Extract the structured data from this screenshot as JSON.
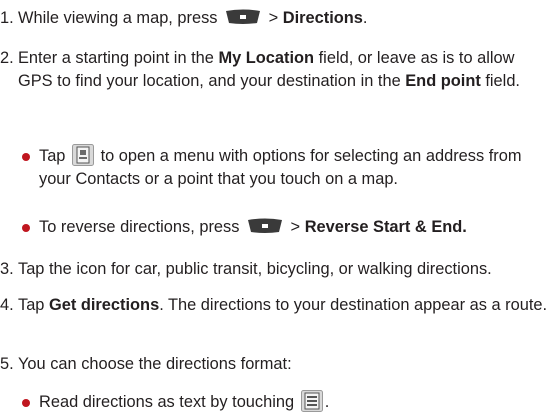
{
  "steps": [
    {
      "num": "1.",
      "pre": "While viewing a map, press",
      "icon": "menu-key-icon",
      "mid": " > ",
      "bold": "Directions",
      "post": "."
    },
    {
      "num": "2.",
      "t1": "Enter a starting point in the ",
      "b1": "My Location",
      "t2": " field, or leave as is to allow GPS to find your location, and your destination in the ",
      "b2": "End point",
      "t3": " field."
    },
    {
      "num": "3.",
      "text": "Tap the icon for car, public transit, bicycling, or walking directions."
    },
    {
      "num": "4.",
      "t1": "Tap ",
      "b1": "Get directions",
      "t2": ". The directions to your destination appear as a route."
    },
    {
      "num": "5.",
      "text": "You can choose the directions format:"
    }
  ],
  "bullets": [
    {
      "pre": "Tap",
      "icon": "contact-picker-icon",
      "post": "to open a menu with options for selecting an address from your Contacts or a point that you touch on a map."
    },
    {
      "pre": "To reverse directions, press",
      "icon": "menu-key-icon",
      "mid": " > ",
      "bold": "Reverse Start & End."
    },
    {
      "pre": "Read directions as text by touching",
      "icon": "list-view-icon",
      "post": "."
    }
  ],
  "colors": {
    "text": "#231f20",
    "bullet": "#c0161f",
    "menu_key": "#3a3a3a"
  }
}
